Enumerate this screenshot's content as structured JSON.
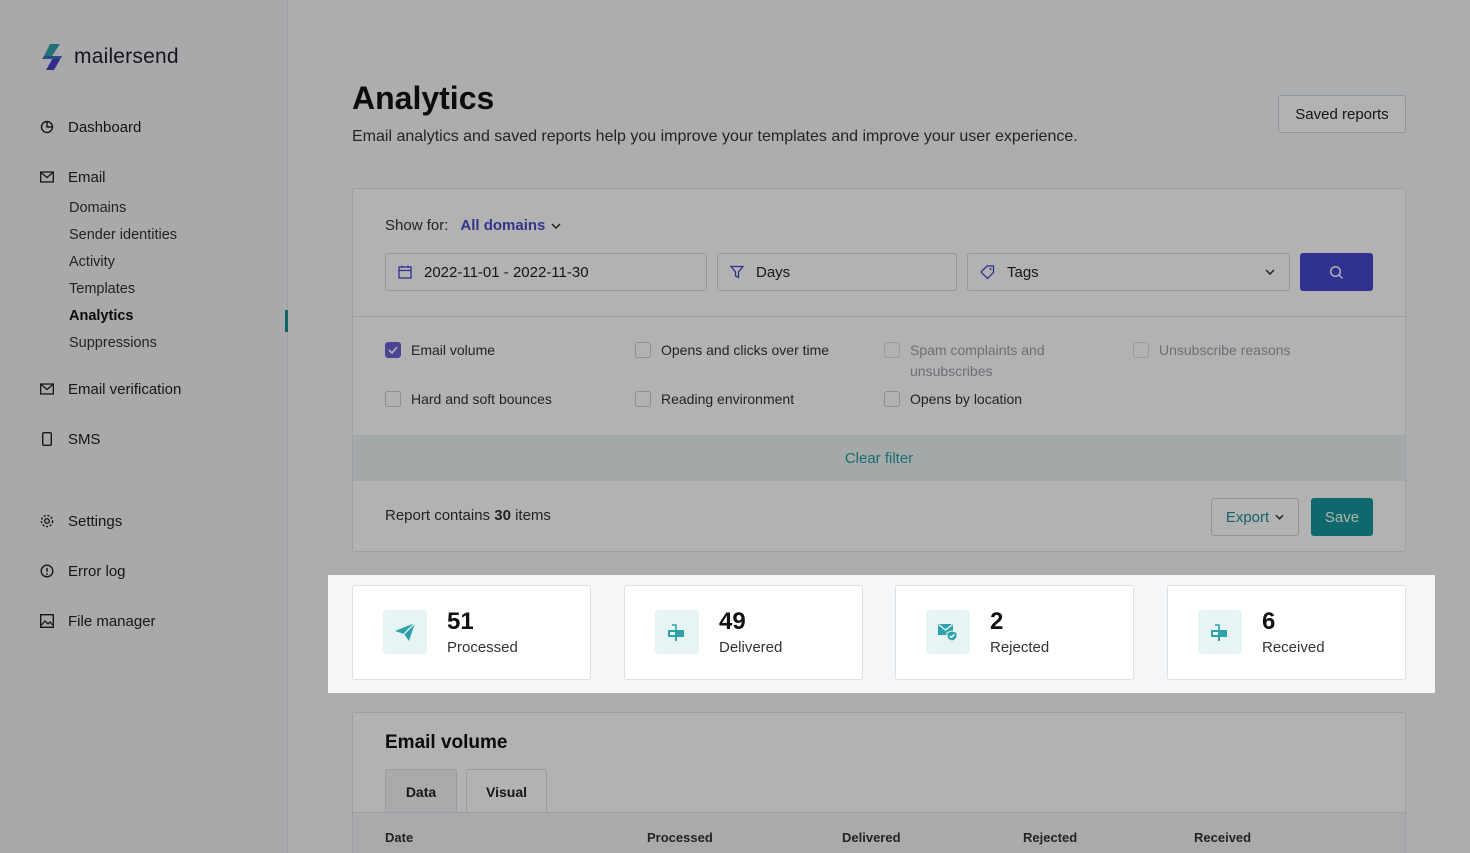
{
  "brand": {
    "name": "mailersend"
  },
  "sidebar": {
    "items": [
      {
        "label": "Dashboard",
        "icon": "pie-chart-icon"
      },
      {
        "label": "Email",
        "icon": "mail-icon"
      },
      {
        "label": "Email verification",
        "icon": "mail-check-icon"
      },
      {
        "label": "SMS",
        "icon": "phone-icon"
      },
      {
        "label": "Settings",
        "icon": "gear-icon"
      },
      {
        "label": "Error log",
        "icon": "alert-circle-icon"
      },
      {
        "label": "File manager",
        "icon": "image-icon"
      }
    ],
    "email_sub": [
      "Domains",
      "Sender identities",
      "Activity",
      "Templates",
      "Analytics",
      "Suppressions"
    ]
  },
  "header": {
    "title": "Analytics",
    "subtitle": "Email analytics and saved reports help you improve your templates and improve your user experience.",
    "saved_reports": "Saved reports"
  },
  "filters": {
    "show_for_label": "Show for:",
    "domain": "All domains",
    "date_range": "2022-11-01 - 2022-11-30",
    "grouping": "Days",
    "tags_placeholder": "Tags",
    "checkboxes": [
      {
        "label": "Email volume",
        "checked": true,
        "disabled": false
      },
      {
        "label": "Opens and clicks over time",
        "checked": false,
        "disabled": false
      },
      {
        "label": "Spam complaints and unsubscribes",
        "checked": false,
        "disabled": true
      },
      {
        "label": "Unsubscribe reasons",
        "checked": false,
        "disabled": true
      },
      {
        "label": "Hard and soft bounces",
        "checked": false,
        "disabled": false
      },
      {
        "label": "Reading environment",
        "checked": false,
        "disabled": false
      },
      {
        "label": "Opens by location",
        "checked": false,
        "disabled": false
      }
    ],
    "clear_filter": "Clear filter"
  },
  "report": {
    "prefix": "Report contains",
    "count": "30",
    "suffix": "items",
    "export": "Export",
    "save": "Save"
  },
  "stats": [
    {
      "value": "51",
      "label": "Processed",
      "icon": "send-icon"
    },
    {
      "value": "49",
      "label": "Delivered",
      "icon": "mailbox-icon"
    },
    {
      "value": "2",
      "label": "Rejected",
      "icon": "mail-shield-icon"
    },
    {
      "value": "6",
      "label": "Received",
      "icon": "mailbox-icon"
    }
  ],
  "email_volume": {
    "title": "Email volume",
    "tabs": [
      "Data",
      "Visual"
    ],
    "columns": [
      "Date",
      "Processed",
      "Delivered",
      "Rejected",
      "Received"
    ]
  },
  "colors": {
    "accent": "#16959a",
    "primary": "#4646cf",
    "check": "#6d61d6"
  }
}
